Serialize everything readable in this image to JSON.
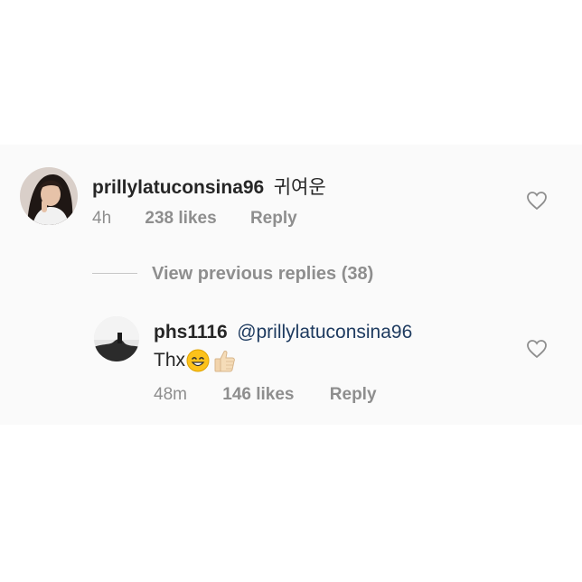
{
  "comment": {
    "username": "prillylatuconsina96",
    "text": "귀여운",
    "time": "4h",
    "likes": "238 likes",
    "reply_label": "Reply",
    "like_icon": "heart-outline-icon"
  },
  "view_previous": {
    "label": "View previous replies (38)"
  },
  "reply": {
    "username": "phs1116",
    "mention": "@prillylatuconsina96",
    "text": "Thx",
    "emojis": [
      "smiling-face-emoji",
      "thumbs-up-emoji"
    ],
    "time": "48m",
    "likes": "146 likes",
    "reply_label": "Reply",
    "like_icon": "heart-outline-icon"
  },
  "colors": {
    "username": "#262626",
    "meta": "#8e8e8e",
    "mention": "#1d3a5f"
  }
}
